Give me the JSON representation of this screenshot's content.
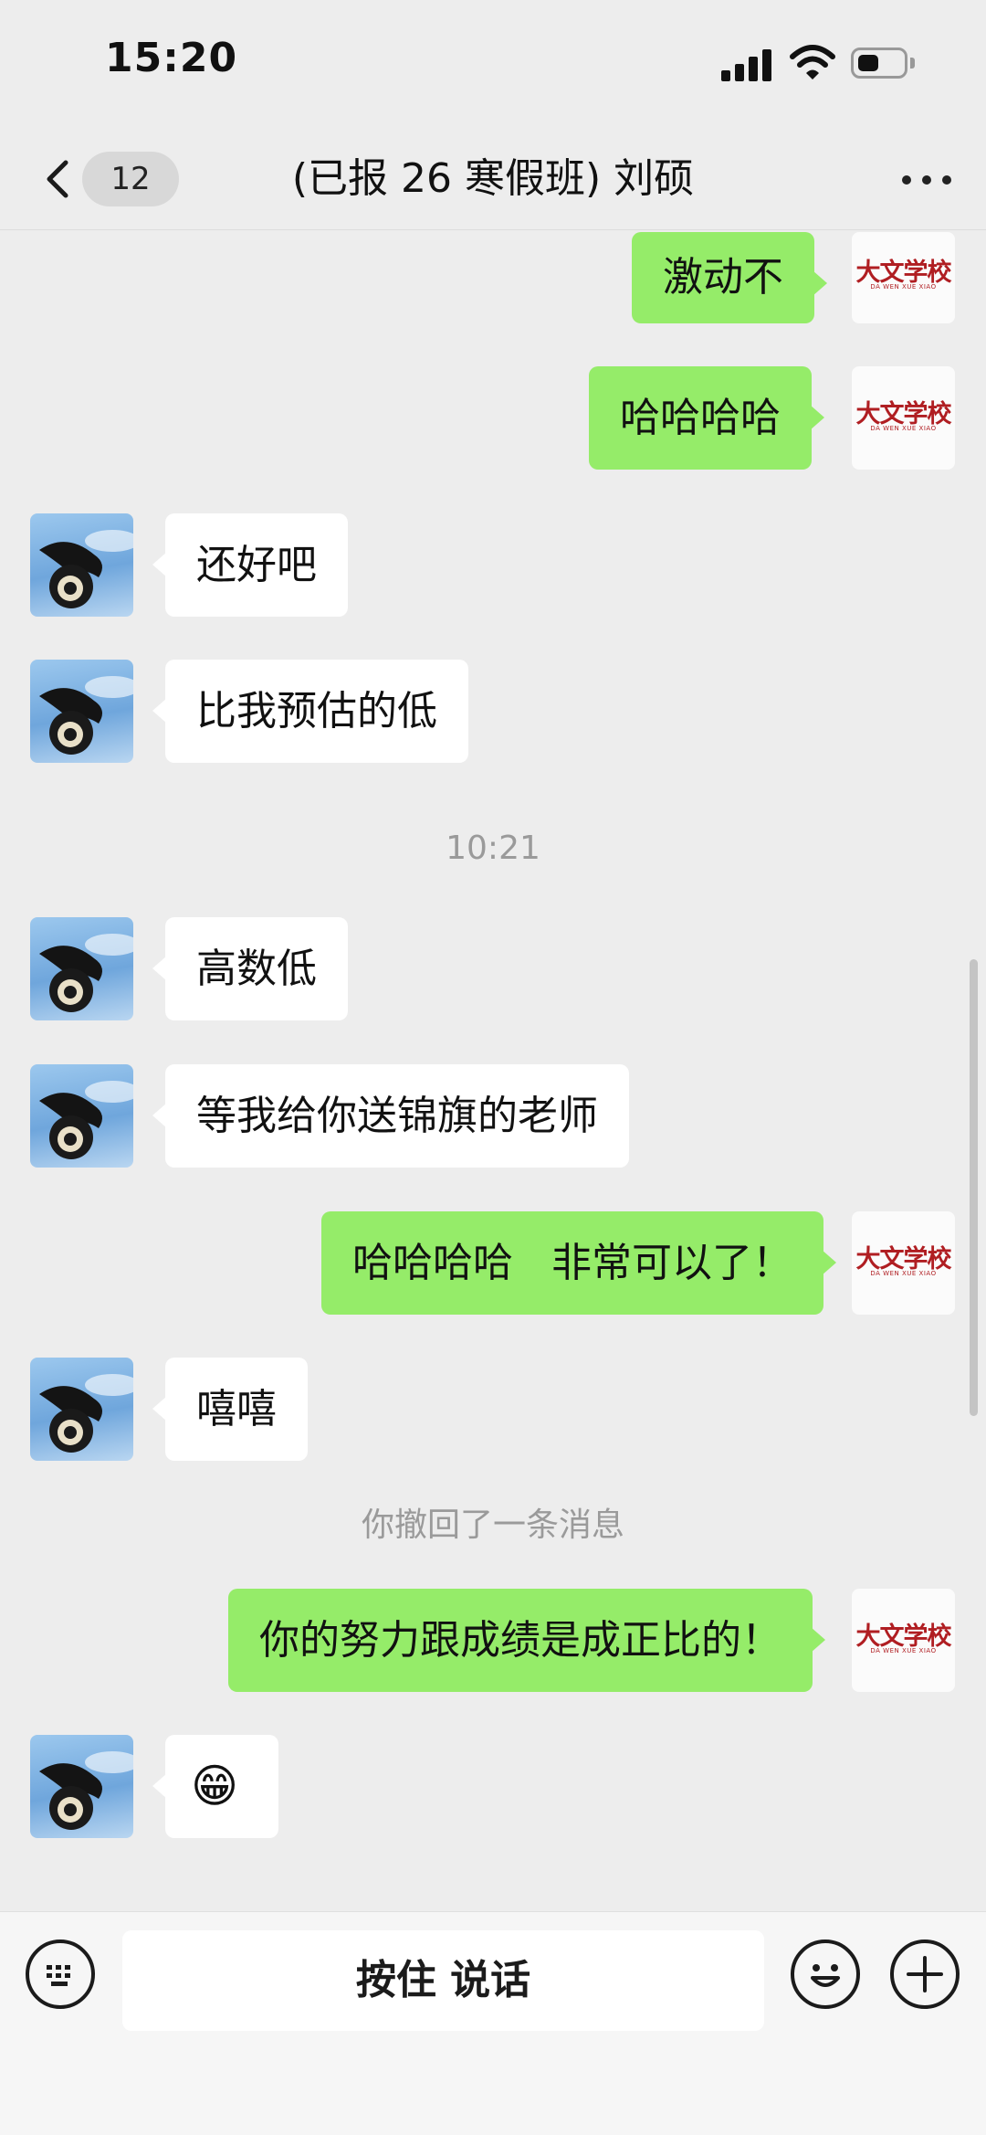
{
  "status_bar": {
    "time": "15:20"
  },
  "nav": {
    "back_badge": "12",
    "title": "(已报 26 寒假班) 刘硕",
    "icons": [
      "chevron-left-icon",
      "more-icon"
    ]
  },
  "contact_avatar": {
    "description": "dog-photo-avatar"
  },
  "self_avatar": {
    "logo_text": "大文学校",
    "logo_sub": "DA WEN XUE XIAO"
  },
  "messages": [
    {
      "side": "right",
      "text": "激动不"
    },
    {
      "side": "right",
      "text": "哈哈哈哈"
    },
    {
      "side": "left",
      "text": "还好吧"
    },
    {
      "side": "left",
      "text": "比我预估的低"
    },
    {
      "type": "timestamp",
      "text": "10:21"
    },
    {
      "side": "left",
      "text": "高数低"
    },
    {
      "side": "left",
      "text": "等我给你送锦旗的老师"
    },
    {
      "side": "right",
      "text": "哈哈哈哈   非常可以了！"
    },
    {
      "side": "left",
      "text": "嘻嘻"
    },
    {
      "type": "system",
      "text": "你撤回了一条消息"
    },
    {
      "side": "right",
      "text": "你的努力跟成绩是成正比的！"
    },
    {
      "side": "left",
      "text": "😁"
    }
  ],
  "input_bar": {
    "hold_to_talk": "按住 说话",
    "icons": [
      "keyboard-icon",
      "emoji-icon",
      "plus-icon"
    ]
  }
}
